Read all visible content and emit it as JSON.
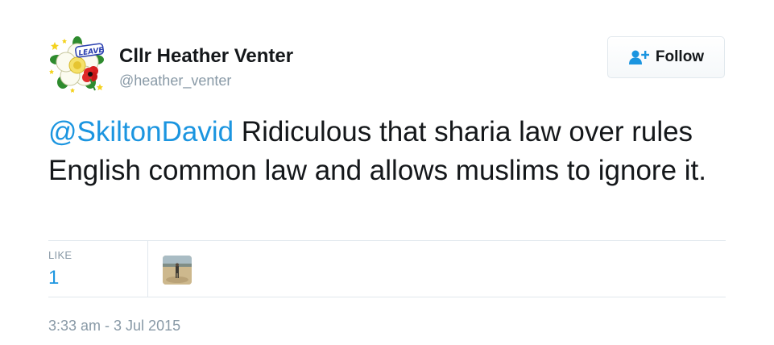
{
  "author": {
    "display_name": "Cllr Heather Venter",
    "handle": "@heather_venter",
    "avatar_badge_text": "LEAVE",
    "avatar_icon": "yorkshire-rose-poppy-avatar"
  },
  "follow_button": {
    "label": "Follow",
    "icon": "add-user-icon"
  },
  "tweet": {
    "mention": "@SkiltonDavid",
    "body": " Ridiculous that sharia law over rules English common law and allows muslims to ignore it."
  },
  "stats": {
    "likes_label": "LIKE",
    "likes_count": "1",
    "liker_avatar_icon": "beach-photo-avatar"
  },
  "timestamp": "3:33 am - 3 Jul 2015",
  "colors": {
    "link": "#1b95e0",
    "text": "#14171a",
    "muted": "#8899a6",
    "border": "#e1e8ed"
  }
}
